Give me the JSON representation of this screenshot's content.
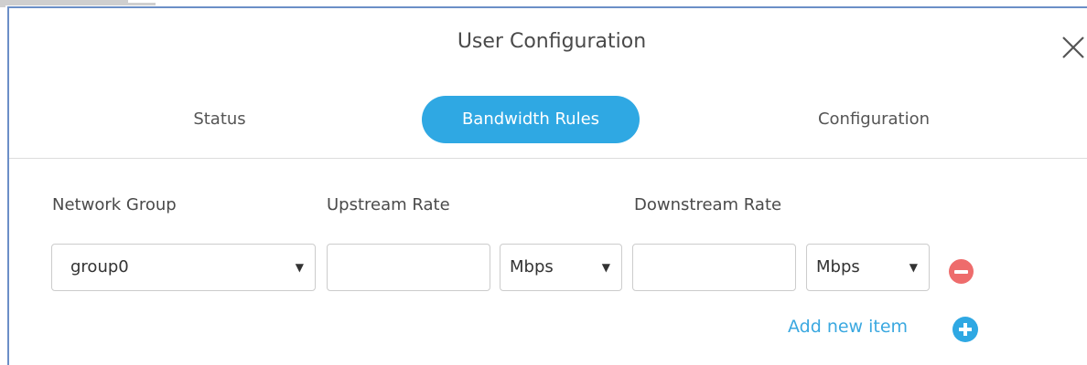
{
  "dialog": {
    "title": "User Configuration"
  },
  "tabs": [
    {
      "label": "Status",
      "active": false
    },
    {
      "label": "Bandwidth Rules",
      "active": true
    },
    {
      "label": "Configuration",
      "active": false
    }
  ],
  "form": {
    "network_group_label": "Network Group",
    "upstream_label": "Upstream Rate",
    "downstream_label": "Downstream Rate",
    "row": {
      "network_group": "group0",
      "upstream_value": "",
      "upstream_unit": "Mbps",
      "downstream_value": "",
      "downstream_unit": "Mbps"
    },
    "add_item_label": "Add new item"
  },
  "icons": {
    "close": "close-icon",
    "remove": "minus-circle-icon",
    "add": "plus-circle-icon",
    "dropdown": "chevron-down-icon"
  },
  "colors": {
    "accent": "#2fa8e3",
    "remove": "#ee6c6c",
    "link": "#3aa8e0",
    "border": "#6b8fc7"
  }
}
